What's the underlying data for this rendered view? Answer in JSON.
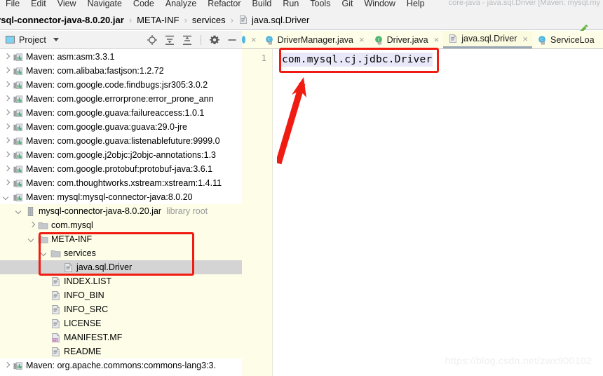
{
  "window": {
    "title": "core-java - java.sql.Driver [Maven: mysql.my"
  },
  "menubar": {
    "items": [
      {
        "label": "File"
      },
      {
        "label": "Edit"
      },
      {
        "label": "View"
      },
      {
        "label": "Navigate"
      },
      {
        "label": "Code"
      },
      {
        "label": "Analyze"
      },
      {
        "label": "Refactor"
      },
      {
        "label": "Build"
      },
      {
        "label": "Run"
      },
      {
        "label": "Tools"
      },
      {
        "label": "Git"
      },
      {
        "label": "Window"
      },
      {
        "label": "Help"
      }
    ]
  },
  "breadcrumb": {
    "separator": "›",
    "items": [
      {
        "label": "ysql-connector-java-8.0.20.jar",
        "bold": true,
        "icon": ""
      },
      {
        "label": "META-INF",
        "bold": false,
        "icon": ""
      },
      {
        "label": "services",
        "bold": false,
        "icon": ""
      },
      {
        "label": "java.sql.Driver",
        "bold": false,
        "icon": "file-icon"
      }
    ],
    "build_icon": "hammer-icon"
  },
  "project_panel": {
    "title": "Project",
    "tools": [
      {
        "name": "locate-icon"
      },
      {
        "name": "expand-all-icon"
      },
      {
        "name": "collapse-all-icon"
      },
      {
        "name": "settings-gear-icon"
      },
      {
        "name": "hide-minimize-icon"
      }
    ]
  },
  "editor_tabs": [
    {
      "label": "DriverManager.java",
      "icon": "class-icon",
      "active": false,
      "close": "×"
    },
    {
      "label": "Driver.java",
      "icon": "interface-icon",
      "active": false,
      "close": "×"
    },
    {
      "label": "java.sql.Driver",
      "icon": "file-icon",
      "active": true,
      "close": "×"
    },
    {
      "label": "ServiceLoa",
      "icon": "class-icon",
      "active": false,
      "close": ""
    }
  ],
  "editor": {
    "line_number": "1",
    "content": "com.mysql.cj.jdbc.Driver"
  },
  "tree": [
    {
      "indent": 1,
      "state": "collapsed",
      "icon": "maven-lib-icon",
      "label": "Maven: asm:asm:3.3.1",
      "suffix": "",
      "selected": false
    },
    {
      "indent": 1,
      "state": "collapsed",
      "icon": "maven-lib-icon",
      "label": "Maven: com.alibaba:fastjson:1.2.72",
      "suffix": "",
      "selected": false
    },
    {
      "indent": 1,
      "state": "collapsed",
      "icon": "maven-lib-icon",
      "label": "Maven: com.google.code.findbugs:jsr305:3.0.2",
      "suffix": "",
      "selected": false
    },
    {
      "indent": 1,
      "state": "collapsed",
      "icon": "maven-lib-icon",
      "label": "Maven: com.google.errorprone:error_prone_ann",
      "suffix": "",
      "selected": false
    },
    {
      "indent": 1,
      "state": "collapsed",
      "icon": "maven-lib-icon",
      "label": "Maven: com.google.guava:failureaccess:1.0.1",
      "suffix": "",
      "selected": false
    },
    {
      "indent": 1,
      "state": "collapsed",
      "icon": "maven-lib-icon",
      "label": "Maven: com.google.guava:guava:29.0-jre",
      "suffix": "",
      "selected": false
    },
    {
      "indent": 1,
      "state": "collapsed",
      "icon": "maven-lib-icon",
      "label": "Maven: com.google.guava:listenablefuture:9999.0",
      "suffix": "",
      "selected": false
    },
    {
      "indent": 1,
      "state": "collapsed",
      "icon": "maven-lib-icon",
      "label": "Maven: com.google.j2objc:j2objc-annotations:1.3",
      "suffix": "",
      "selected": false
    },
    {
      "indent": 1,
      "state": "collapsed",
      "icon": "maven-lib-icon",
      "label": "Maven: com.google.protobuf:protobuf-java:3.6.1",
      "suffix": "",
      "selected": false
    },
    {
      "indent": 1,
      "state": "collapsed",
      "icon": "maven-lib-icon",
      "label": "Maven: com.thoughtworks.xstream:xstream:1.4.11",
      "suffix": "",
      "selected": false
    },
    {
      "indent": 1,
      "state": "expanded",
      "icon": "maven-lib-icon",
      "label": "Maven: mysql:mysql-connector-java:8.0.20",
      "suffix": "",
      "selected": false
    },
    {
      "indent": 2,
      "state": "expanded",
      "icon": "jar-icon",
      "label": "mysql-connector-java-8.0.20.jar",
      "suffix": "library root",
      "selected": false
    },
    {
      "indent": 3,
      "state": "collapsed",
      "icon": "folder-icon",
      "label": "com.mysql",
      "suffix": "",
      "selected": false
    },
    {
      "indent": 3,
      "state": "expanded",
      "icon": "folder-icon",
      "label": "META-INF",
      "suffix": "",
      "selected": false
    },
    {
      "indent": 4,
      "state": "expanded",
      "icon": "folder-icon",
      "label": "services",
      "suffix": "",
      "selected": false
    },
    {
      "indent": 5,
      "state": "none",
      "icon": "file-icon",
      "label": "java.sql.Driver",
      "suffix": "",
      "selected": true
    },
    {
      "indent": 4,
      "state": "none",
      "icon": "file-icon",
      "label": "INDEX.LIST",
      "suffix": "",
      "selected": false
    },
    {
      "indent": 4,
      "state": "none",
      "icon": "file-icon",
      "label": "INFO_BIN",
      "suffix": "",
      "selected": false
    },
    {
      "indent": 4,
      "state": "none",
      "icon": "file-icon",
      "label": "INFO_SRC",
      "suffix": "",
      "selected": false
    },
    {
      "indent": 4,
      "state": "none",
      "icon": "file-icon",
      "label": "LICENSE",
      "suffix": "",
      "selected": false
    },
    {
      "indent": 4,
      "state": "none",
      "icon": "manifest-icon",
      "label": "MANIFEST.MF",
      "suffix": "",
      "selected": false
    },
    {
      "indent": 4,
      "state": "none",
      "icon": "file-icon",
      "label": "README",
      "suffix": "",
      "selected": false
    },
    {
      "indent": 1,
      "state": "collapsed",
      "icon": "maven-lib-icon",
      "label": "Maven: org.apache.commons:commons-lang3:3.",
      "suffix": "",
      "selected": false
    }
  ],
  "annotations": {
    "editor_highlight": "red-rectangle",
    "tree_highlight": "red-rectangle",
    "pointer": "red-arrow"
  },
  "watermark": "https://blog.csdn.net/zwx900102",
  "colors": {
    "annotation_red": "#f01c12",
    "cream_background": "#fdfde8",
    "selection_gray": "#d4d4d4",
    "code_selection": "#e8e8f8"
  }
}
